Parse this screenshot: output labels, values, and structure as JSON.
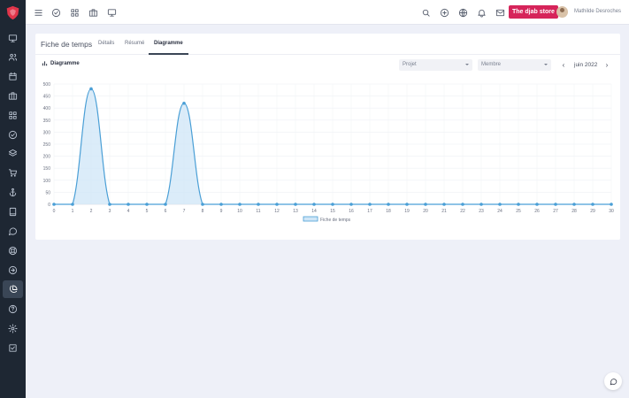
{
  "topbar": {
    "store_label": "The djab store",
    "user_name": "Mathilde Desroches"
  },
  "card": {
    "title": "Fiche de temps",
    "tabs": [
      {
        "label": "Détails",
        "active": false
      },
      {
        "label": "Résumé",
        "active": false
      },
      {
        "label": "Diagramme",
        "active": true
      }
    ]
  },
  "section": {
    "title": "Diagramme"
  },
  "filters": {
    "project_label": "Projet",
    "member_label": "Membre",
    "month": "juin 2022"
  },
  "colors": {
    "accent": "#d6245a",
    "sidebar": "#1e2733",
    "line": "#4a9fd6",
    "fill": "#cfe6f7"
  },
  "icons": {
    "sidebar": [
      "monitor-icon",
      "users-icon",
      "calendar-icon",
      "briefcase-icon",
      "grid-icon",
      "check-circle-icon",
      "layers-icon",
      "cart-icon",
      "anchor-icon",
      "book-icon",
      "chat-icon",
      "support-icon",
      "arrow-right-circle-icon",
      "pie-chart-icon",
      "help-icon",
      "settings-icon",
      "check-square-icon"
    ],
    "topbar": [
      "menu-icon",
      "check-circle-icon",
      "grid-icon",
      "briefcase-icon",
      "monitor-icon",
      "search-icon",
      "plus-circle-icon",
      "globe-icon",
      "bell-icon",
      "mail-icon"
    ]
  },
  "chart_data": {
    "type": "area",
    "x": [
      0,
      1,
      2,
      3,
      4,
      5,
      6,
      7,
      8,
      9,
      10,
      11,
      12,
      13,
      14,
      15,
      16,
      17,
      18,
      19,
      20,
      21,
      22,
      23,
      24,
      25,
      26,
      27,
      28,
      29,
      30
    ],
    "series": [
      {
        "name": "Fiche de temps",
        "values": [
          0,
          0,
          480,
          0,
          0,
          0,
          0,
          420,
          0,
          0,
          0,
          0,
          0,
          0,
          0,
          0,
          0,
          0,
          0,
          0,
          0,
          0,
          0,
          0,
          0,
          0,
          0,
          0,
          0,
          0,
          0
        ]
      }
    ],
    "ylim": [
      0,
      500
    ],
    "yticks": [
      0,
      50,
      100,
      150,
      200,
      250,
      300,
      350,
      400,
      450,
      500
    ],
    "grid": true,
    "legend": "bottom"
  }
}
